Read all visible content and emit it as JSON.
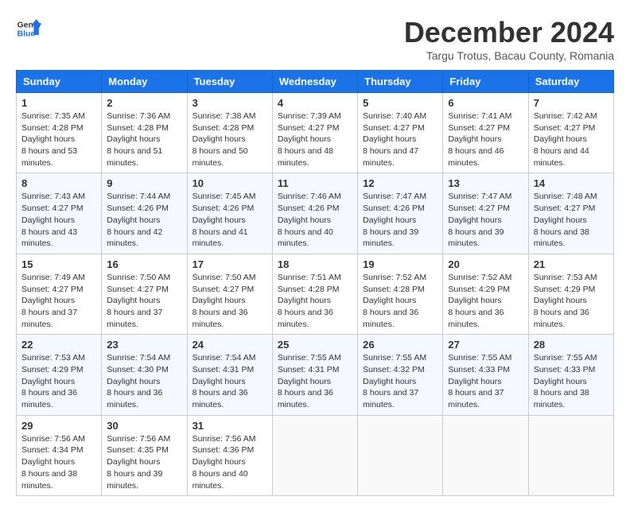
{
  "header": {
    "logo_line1": "General",
    "logo_line2": "Blue",
    "month": "December 2024",
    "location": "Targu Trotus, Bacau County, Romania"
  },
  "days_of_week": [
    "Sunday",
    "Monday",
    "Tuesday",
    "Wednesday",
    "Thursday",
    "Friday",
    "Saturday"
  ],
  "weeks": [
    [
      {
        "day": "1",
        "rise": "7:35 AM",
        "set": "4:28 PM",
        "daylight": "8 hours and 53 minutes."
      },
      {
        "day": "2",
        "rise": "7:36 AM",
        "set": "4:28 PM",
        "daylight": "8 hours and 51 minutes."
      },
      {
        "day": "3",
        "rise": "7:38 AM",
        "set": "4:28 PM",
        "daylight": "8 hours and 50 minutes."
      },
      {
        "day": "4",
        "rise": "7:39 AM",
        "set": "4:27 PM",
        "daylight": "8 hours and 48 minutes."
      },
      {
        "day": "5",
        "rise": "7:40 AM",
        "set": "4:27 PM",
        "daylight": "8 hours and 47 minutes."
      },
      {
        "day": "6",
        "rise": "7:41 AM",
        "set": "4:27 PM",
        "daylight": "8 hours and 46 minutes."
      },
      {
        "day": "7",
        "rise": "7:42 AM",
        "set": "4:27 PM",
        "daylight": "8 hours and 44 minutes."
      }
    ],
    [
      {
        "day": "8",
        "rise": "7:43 AM",
        "set": "4:27 PM",
        "daylight": "8 hours and 43 minutes."
      },
      {
        "day": "9",
        "rise": "7:44 AM",
        "set": "4:26 PM",
        "daylight": "8 hours and 42 minutes."
      },
      {
        "day": "10",
        "rise": "7:45 AM",
        "set": "4:26 PM",
        "daylight": "8 hours and 41 minutes."
      },
      {
        "day": "11",
        "rise": "7:46 AM",
        "set": "4:26 PM",
        "daylight": "8 hours and 40 minutes."
      },
      {
        "day": "12",
        "rise": "7:47 AM",
        "set": "4:26 PM",
        "daylight": "8 hours and 39 minutes."
      },
      {
        "day": "13",
        "rise": "7:47 AM",
        "set": "4:27 PM",
        "daylight": "8 hours and 39 minutes."
      },
      {
        "day": "14",
        "rise": "7:48 AM",
        "set": "4:27 PM",
        "daylight": "8 hours and 38 minutes."
      }
    ],
    [
      {
        "day": "15",
        "rise": "7:49 AM",
        "set": "4:27 PM",
        "daylight": "8 hours and 37 minutes."
      },
      {
        "day": "16",
        "rise": "7:50 AM",
        "set": "4:27 PM",
        "daylight": "8 hours and 37 minutes."
      },
      {
        "day": "17",
        "rise": "7:50 AM",
        "set": "4:27 PM",
        "daylight": "8 hours and 36 minutes."
      },
      {
        "day": "18",
        "rise": "7:51 AM",
        "set": "4:28 PM",
        "daylight": "8 hours and 36 minutes."
      },
      {
        "day": "19",
        "rise": "7:52 AM",
        "set": "4:28 PM",
        "daylight": "8 hours and 36 minutes."
      },
      {
        "day": "20",
        "rise": "7:52 AM",
        "set": "4:29 PM",
        "daylight": "8 hours and 36 minutes."
      },
      {
        "day": "21",
        "rise": "7:53 AM",
        "set": "4:29 PM",
        "daylight": "8 hours and 36 minutes."
      }
    ],
    [
      {
        "day": "22",
        "rise": "7:53 AM",
        "set": "4:29 PM",
        "daylight": "8 hours and 36 minutes."
      },
      {
        "day": "23",
        "rise": "7:54 AM",
        "set": "4:30 PM",
        "daylight": "8 hours and 36 minutes."
      },
      {
        "day": "24",
        "rise": "7:54 AM",
        "set": "4:31 PM",
        "daylight": "8 hours and 36 minutes."
      },
      {
        "day": "25",
        "rise": "7:55 AM",
        "set": "4:31 PM",
        "daylight": "8 hours and 36 minutes."
      },
      {
        "day": "26",
        "rise": "7:55 AM",
        "set": "4:32 PM",
        "daylight": "8 hours and 37 minutes."
      },
      {
        "day": "27",
        "rise": "7:55 AM",
        "set": "4:33 PM",
        "daylight": "8 hours and 37 minutes."
      },
      {
        "day": "28",
        "rise": "7:55 AM",
        "set": "4:33 PM",
        "daylight": "8 hours and 38 minutes."
      }
    ],
    [
      {
        "day": "29",
        "rise": "7:56 AM",
        "set": "4:34 PM",
        "daylight": "8 hours and 38 minutes."
      },
      {
        "day": "30",
        "rise": "7:56 AM",
        "set": "4:35 PM",
        "daylight": "8 hours and 39 minutes."
      },
      {
        "day": "31",
        "rise": "7:56 AM",
        "set": "4:36 PM",
        "daylight": "8 hours and 40 minutes."
      },
      null,
      null,
      null,
      null
    ]
  ],
  "labels": {
    "sunrise": "Sunrise:",
    "sunset": "Sunset:",
    "daylight": "Daylight:"
  }
}
